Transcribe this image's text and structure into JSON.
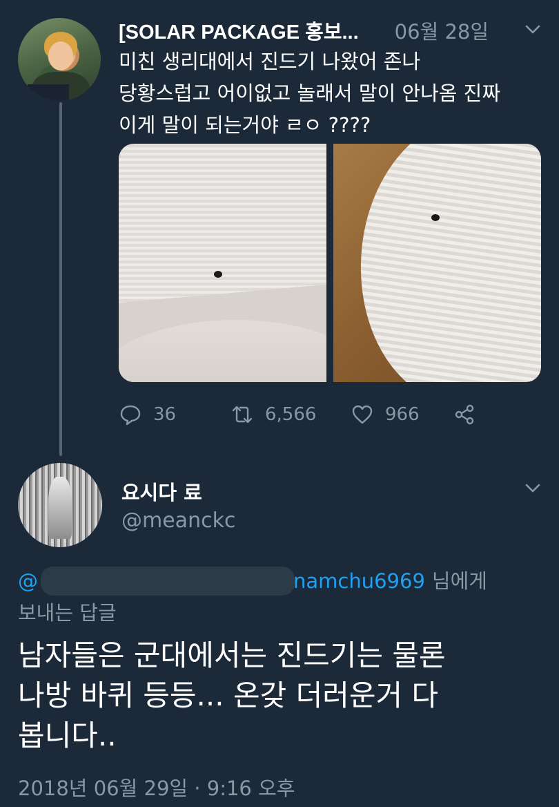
{
  "tweet1": {
    "author_name": "[SOLAR PACKAGE 홍보...",
    "moon_icon": "crescent-moon-icon",
    "date": "06월 28일",
    "lines": [
      "미친 생리대에서 진드기 나왔어 존나",
      "당황스럽고 어이없고 놀래서 말이 안나옴 진짜",
      "이게 말이 되는거야 ㄹㅇ ????"
    ],
    "photos": [
      "photo-1",
      "photo-2"
    ],
    "replies": "36",
    "retweets": "6,566",
    "likes": "966"
  },
  "tweet2": {
    "author_name": "요시다 료",
    "handle": "@meanckc",
    "reply_to_prefix": "@",
    "reply_to_visible": "namchu6969",
    "reply_to_suffix": "님에게",
    "reply_to_line2": "보내는 답글",
    "lines": [
      "남자들은 군대에서는 진드기는 물론",
      "나방 바퀴 등등... 온갖 더러운거 다",
      "봅니다.."
    ],
    "timestamp": "2018년 06월 29일 · 9:16 오후"
  },
  "colors": {
    "background": "#1c2938",
    "secondary_text": "#8899a6",
    "link": "#1da1f2"
  }
}
